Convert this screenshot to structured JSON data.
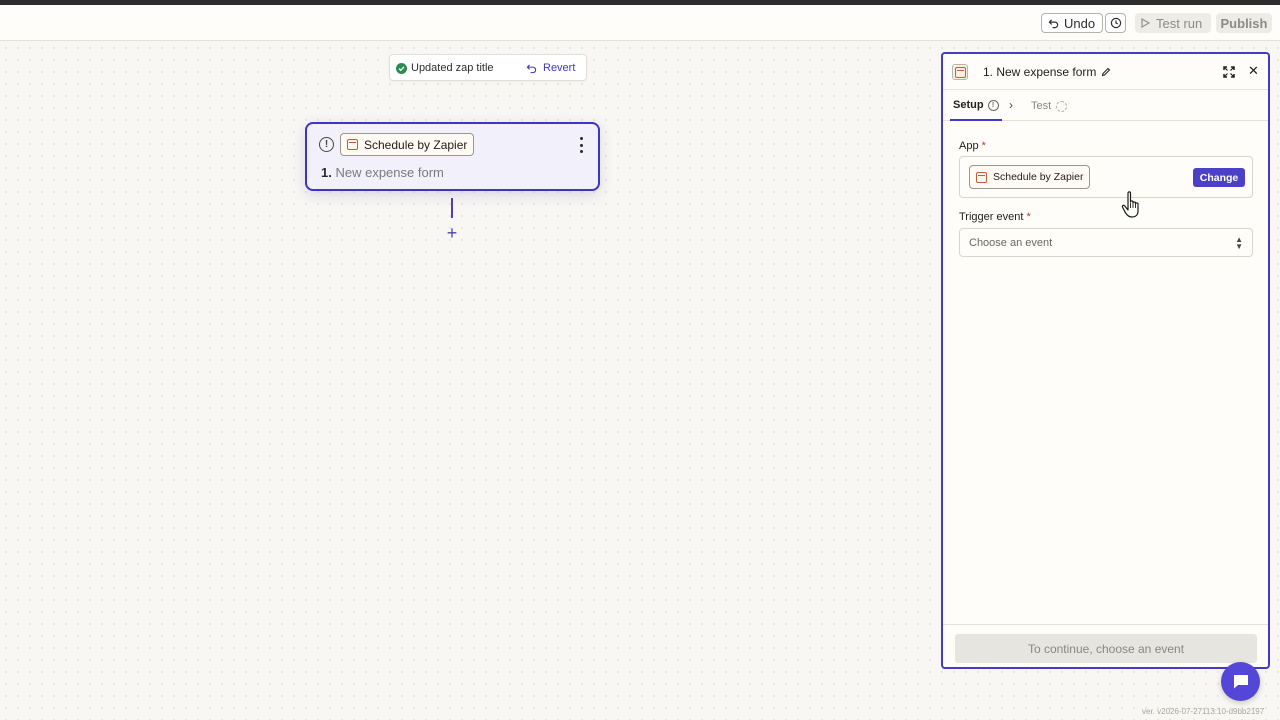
{
  "toolbar": {
    "undo_label": "Undo",
    "test_run_label": "Test run",
    "publish_label": "Publish"
  },
  "toast": {
    "message": "Updated zap title",
    "revert_label": "Revert"
  },
  "step": {
    "app_name": "Schedule by Zapier",
    "number": "1.",
    "title": "New expense form"
  },
  "panel": {
    "title": "1. New expense form",
    "tabs": [
      {
        "label": "Setup"
      },
      {
        "label": "Test"
      }
    ],
    "app_field": {
      "label": "App",
      "required_mark": "*",
      "app_name": "Schedule by Zapier",
      "change_label": "Change"
    },
    "trigger_field": {
      "label": "Trigger event",
      "required_mark": "*",
      "placeholder": "Choose an event"
    },
    "continue_label": "To continue, choose an event"
  },
  "footer": {
    "version": "ver. v2026-07-27113:10-d9bb2197"
  },
  "colors": {
    "accent": "#433ac7",
    "change_button": "#4b40c6",
    "chat_button": "#5446d6",
    "success": "#2e8a53",
    "app_icon": "#c65e35"
  },
  "icons": [
    "undo-icon",
    "history-icon",
    "play-icon",
    "check-circle-icon",
    "revert-icon",
    "warning-icon",
    "calendar-icon",
    "kebab-menu-icon",
    "plus-icon",
    "pencil-icon",
    "expand-icon",
    "close-icon",
    "info-icon",
    "chevron-right-icon",
    "select-arrows-icon",
    "pointer-cursor-icon",
    "chat-icon"
  ]
}
